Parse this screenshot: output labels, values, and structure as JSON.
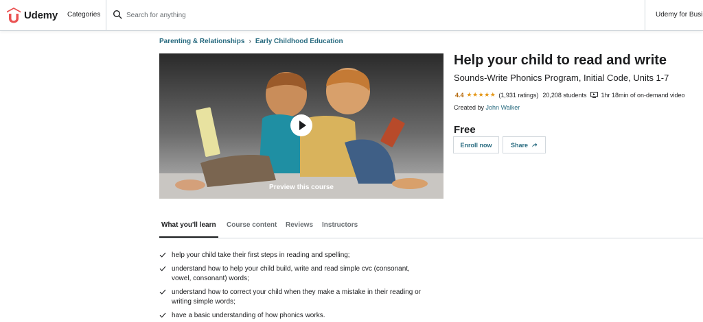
{
  "header": {
    "logo_text": "Udemy",
    "categories_label": "Categories",
    "search_placeholder": "Search for anything",
    "business_label": "Udemy for Business"
  },
  "breadcrumb": {
    "items": [
      "Parenting & Relationships",
      "Early Childhood Education"
    ],
    "separator": "›"
  },
  "preview": {
    "label": "Preview this course"
  },
  "course": {
    "title": "Help your child to read and write",
    "subtitle": "Sounds-Write Phonics Program, Initial Code, Units 1-7",
    "rating": "4.4",
    "stars": "★★★★★",
    "ratings_count": "(1,931 ratings)",
    "students": "20,208 students",
    "video_length": "1hr 18min of on-demand video",
    "created_by_prefix": "Created by",
    "instructor": "John Walker",
    "price": "Free",
    "enroll_label": "Enroll now",
    "share_label": "Share"
  },
  "tabs": [
    {
      "label": "What you'll learn",
      "active": true
    },
    {
      "label": "Course content",
      "active": false
    },
    {
      "label": "Reviews",
      "active": false
    },
    {
      "label": "Instructors",
      "active": false
    }
  ],
  "learn_items": [
    "help your child take their first steps in reading and spelling;",
    "understand how to help your child build, write and read simple cvc (consonant, vowel, consonant) words;",
    "understand how to correct your child when they make a mistake in their reading or writing simple words;",
    "have a basic understanding of how phonics works."
  ],
  "colors": {
    "brand": "#a435f0",
    "logo_red": "#ea5252",
    "link": "#276a7f",
    "star": "#e59819",
    "rating": "#b4690e"
  },
  "icons": {
    "search": "search-icon",
    "play": "play-icon",
    "video": "video-icon",
    "share": "share-arrow-icon",
    "check": "check-icon"
  }
}
